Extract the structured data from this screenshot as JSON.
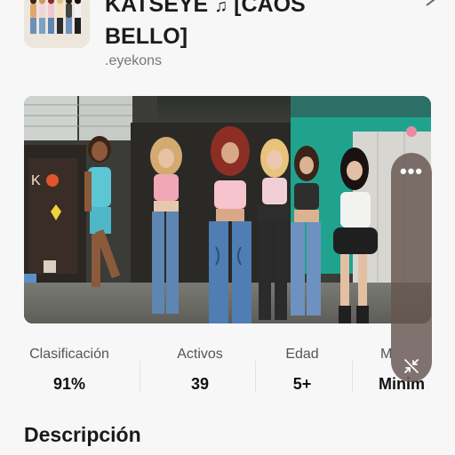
{
  "app": {
    "title_line1": "KATSEYE",
    "title_note": "♫",
    "title_line1_suffix": "[CAOS",
    "title_line2": "BELLO]",
    "developer": ".eyekons"
  },
  "stats": [
    {
      "label": "Clasificación",
      "value": "91%"
    },
    {
      "label": "Activos",
      "value": "39"
    },
    {
      "label": "Edad",
      "value": "5+"
    },
    {
      "label": "M",
      "value": "Minim"
    }
  ],
  "side_panel": {
    "menu_icon": "more-dots-icon",
    "bottom_icon": "minimize-icon"
  },
  "description": {
    "heading": "Descripción"
  },
  "colors": {
    "background": "#f7f7f8",
    "panel": "#655650",
    "teal_wall": "#1fa38e"
  }
}
